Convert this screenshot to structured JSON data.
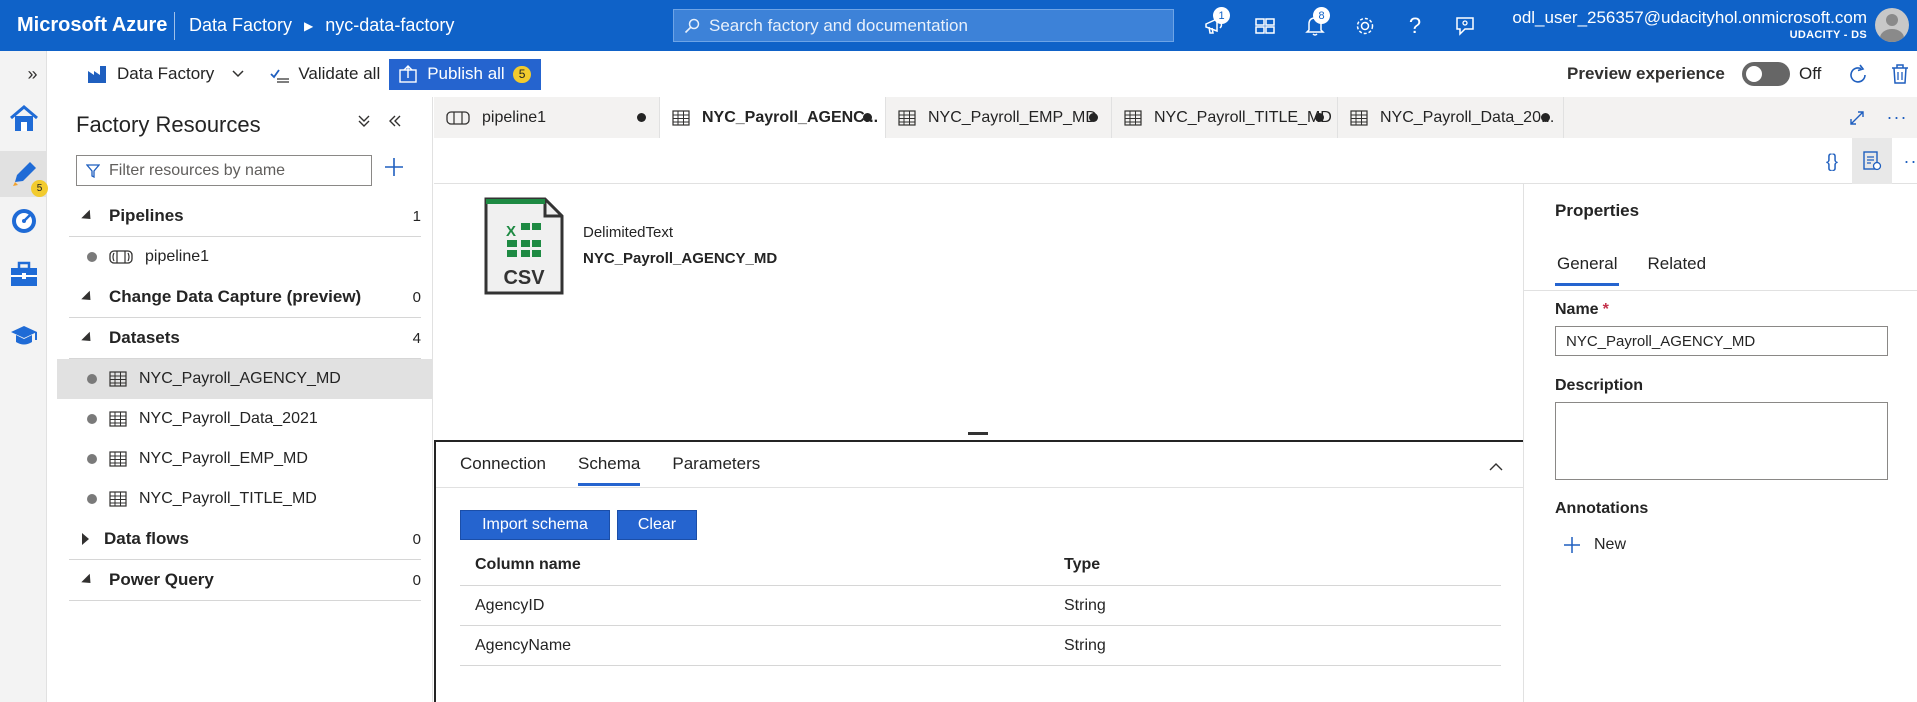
{
  "topbar": {
    "brand": "Microsoft Azure",
    "breadcrumb": [
      "Data Factory",
      "nyc-data-factory"
    ],
    "search_placeholder": "Search factory and documentation",
    "notifications_badge": "1",
    "alerts_badge": "8",
    "user_email": "odl_user_256357@udacityhol.onmicrosoft.com",
    "user_org": "UDACITY - DS"
  },
  "cmdbar": {
    "factory_label": "Data Factory",
    "validate_label": "Validate all",
    "publish_label": "Publish all",
    "publish_count": "5",
    "preview_label": "Preview experience",
    "toggle_state": "Off"
  },
  "rail": {
    "author_badge": "5"
  },
  "resources": {
    "title": "Factory Resources",
    "filter_placeholder": "Filter resources by name",
    "sections": [
      {
        "label": "Pipelines",
        "count": "1"
      },
      {
        "label": "Change Data Capture (preview)",
        "count": "0"
      },
      {
        "label": "Datasets",
        "count": "4"
      },
      {
        "label": "Data flows",
        "count": "0"
      },
      {
        "label": "Power Query",
        "count": "0"
      }
    ],
    "pipelines": [
      "pipeline1"
    ],
    "datasets": [
      "NYC_Payroll_AGENCY_MD",
      "NYC_Payroll_Data_2021",
      "NYC_Payroll_EMP_MD",
      "NYC_Payroll_TITLE_MD"
    ]
  },
  "tabs": [
    "pipeline1",
    "NYC_Payroll_AGENC...",
    "NYC_Payroll_EMP_MD",
    "NYC_Payroll_TITLE_MD",
    "NYC_Payroll_Data_20..."
  ],
  "dataset": {
    "type": "DelimitedText",
    "name": "NYC_Payroll_AGENCY_MD",
    "icon_label": "CSV"
  },
  "bottom": {
    "tabs": [
      "Connection",
      "Schema",
      "Parameters"
    ],
    "import_label": "Import schema",
    "clear_label": "Clear",
    "columns": [
      "Column name",
      "Type"
    ],
    "rows": [
      {
        "name": "AgencyID",
        "type": "String"
      },
      {
        "name": "AgencyName",
        "type": "String"
      }
    ]
  },
  "properties": {
    "title": "Properties",
    "tabs": [
      "General",
      "Related"
    ],
    "name_label": "Name",
    "name_value": "NYC_Payroll_AGENCY_MD",
    "description_label": "Description",
    "description_value": "",
    "annotations_label": "Annotations",
    "new_label": "New"
  },
  "colors": {
    "topbar": "#0f62c8",
    "accent": "#2564cf",
    "badge": "#f2cb2e"
  }
}
